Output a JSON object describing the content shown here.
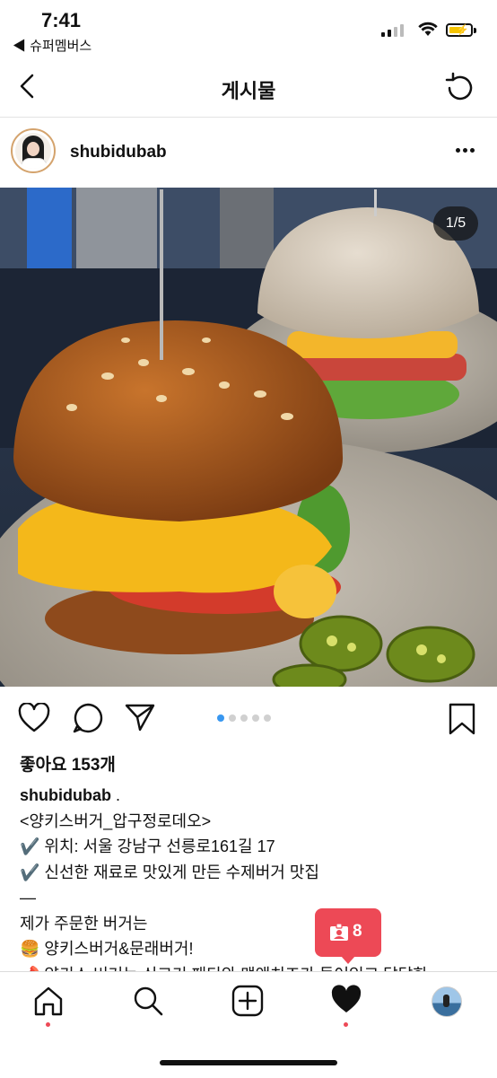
{
  "status_bar": {
    "time": "7:41",
    "back_app": "◀ 슈퍼멤버스"
  },
  "nav": {
    "title": "게시물"
  },
  "post": {
    "username": "shubidubab",
    "image_counter": "1/5",
    "carousel": {
      "count": 5,
      "active": 1
    },
    "likes": "좋아요 153개",
    "caption_user": "shubidubab",
    "caption_lines": [
      "<양키스버거_압구정로데오>",
      "✔️ 위치: 서울 강남구 선릉로161길 17",
      "✔️ 신선한 재료로 맛있게 만든 수제버거 맛집",
      "—",
      "제가 주문한 버거는",
      "🍔 양키스버거&문래버거!",
      "📌 양키스 버거는 쇠고기 패티와 맥앤치즈가 들어있고 달달한"
    ]
  },
  "notification": {
    "count": "8"
  },
  "colors": {
    "accent": "#3897f0",
    "notification": "#ed4956"
  }
}
